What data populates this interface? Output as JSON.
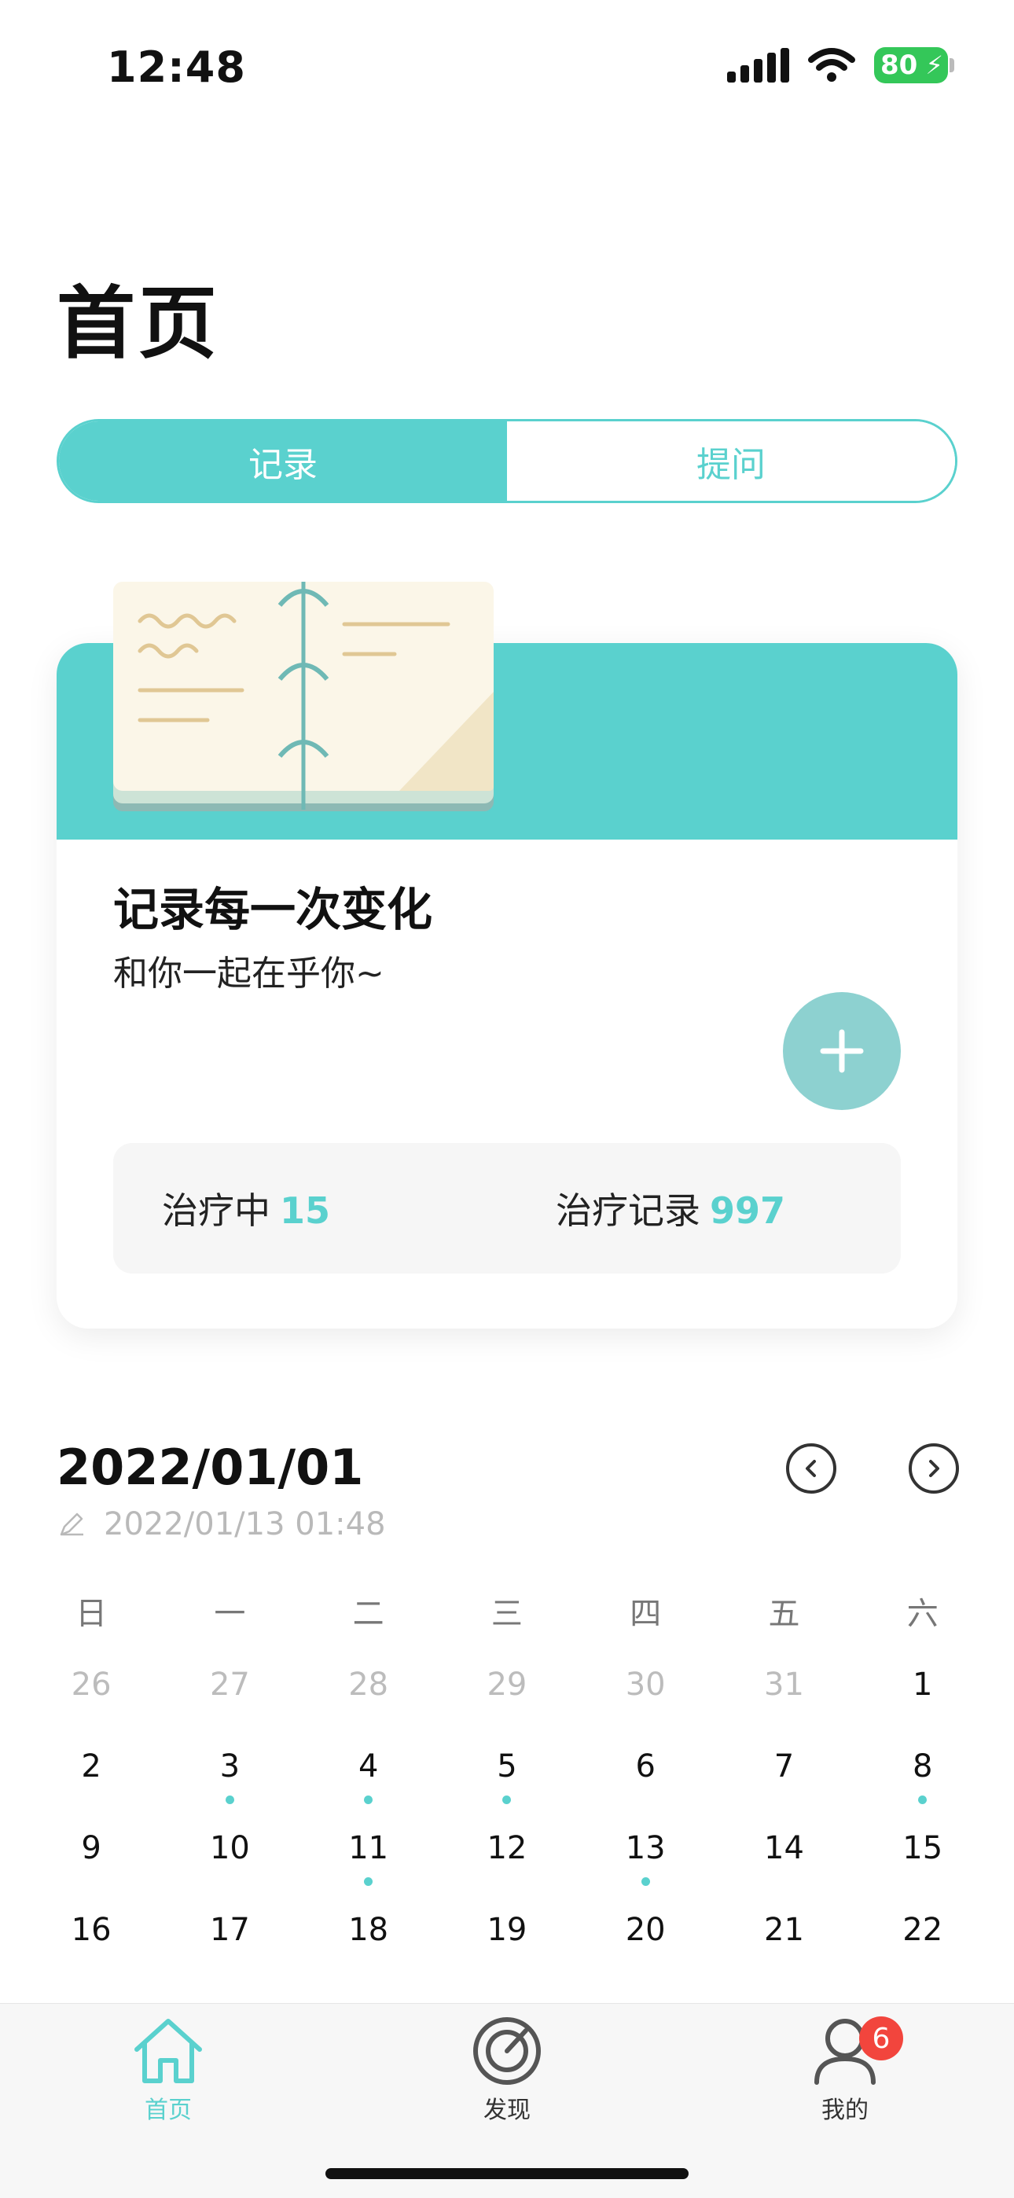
{
  "status_bar": {
    "time": "12:48",
    "battery": "80"
  },
  "page": {
    "title": "首页"
  },
  "segment": {
    "items": [
      "记录",
      "提问"
    ],
    "active_index": 0
  },
  "record_card": {
    "title": "记录每一次变化",
    "subtitle": "和你一起在乎你~",
    "stats": [
      {
        "label": "治疗中",
        "value": "15"
      },
      {
        "label": "治疗记录",
        "value": "997"
      }
    ]
  },
  "date_header": {
    "date": "2022/01/01",
    "edited": "2022/01/13 01:48"
  },
  "calendar": {
    "weekdays": [
      "日",
      "一",
      "二",
      "三",
      "四",
      "五",
      "六"
    ],
    "rows": [
      [
        {
          "d": "26",
          "muted": true
        },
        {
          "d": "27",
          "muted": true
        },
        {
          "d": "28",
          "muted": true
        },
        {
          "d": "29",
          "muted": true
        },
        {
          "d": "30",
          "muted": true
        },
        {
          "d": "31",
          "muted": true
        },
        {
          "d": "1"
        }
      ],
      [
        {
          "d": "2"
        },
        {
          "d": "3",
          "dot": true
        },
        {
          "d": "4",
          "dot": true
        },
        {
          "d": "5",
          "dot": true
        },
        {
          "d": "6"
        },
        {
          "d": "7"
        },
        {
          "d": "8",
          "dot": true
        }
      ],
      [
        {
          "d": "9"
        },
        {
          "d": "10"
        },
        {
          "d": "11",
          "dot": true
        },
        {
          "d": "12"
        },
        {
          "d": "13",
          "dot": true
        },
        {
          "d": "14"
        },
        {
          "d": "15"
        }
      ],
      [
        {
          "d": "16"
        },
        {
          "d": "17"
        },
        {
          "d": "18"
        },
        {
          "d": "19"
        },
        {
          "d": "20"
        },
        {
          "d": "21"
        },
        {
          "d": "22"
        }
      ]
    ]
  },
  "tabbar": {
    "items": [
      {
        "label": "首页",
        "icon": "home-icon",
        "active": true
      },
      {
        "label": "发现",
        "icon": "radar-icon",
        "active": false
      },
      {
        "label": "我的",
        "icon": "user-icon",
        "active": false,
        "badge": "6"
      }
    ]
  },
  "colors": {
    "accent": "#5ad1ce",
    "badge": "#f2453d",
    "battery": "#34c759"
  }
}
